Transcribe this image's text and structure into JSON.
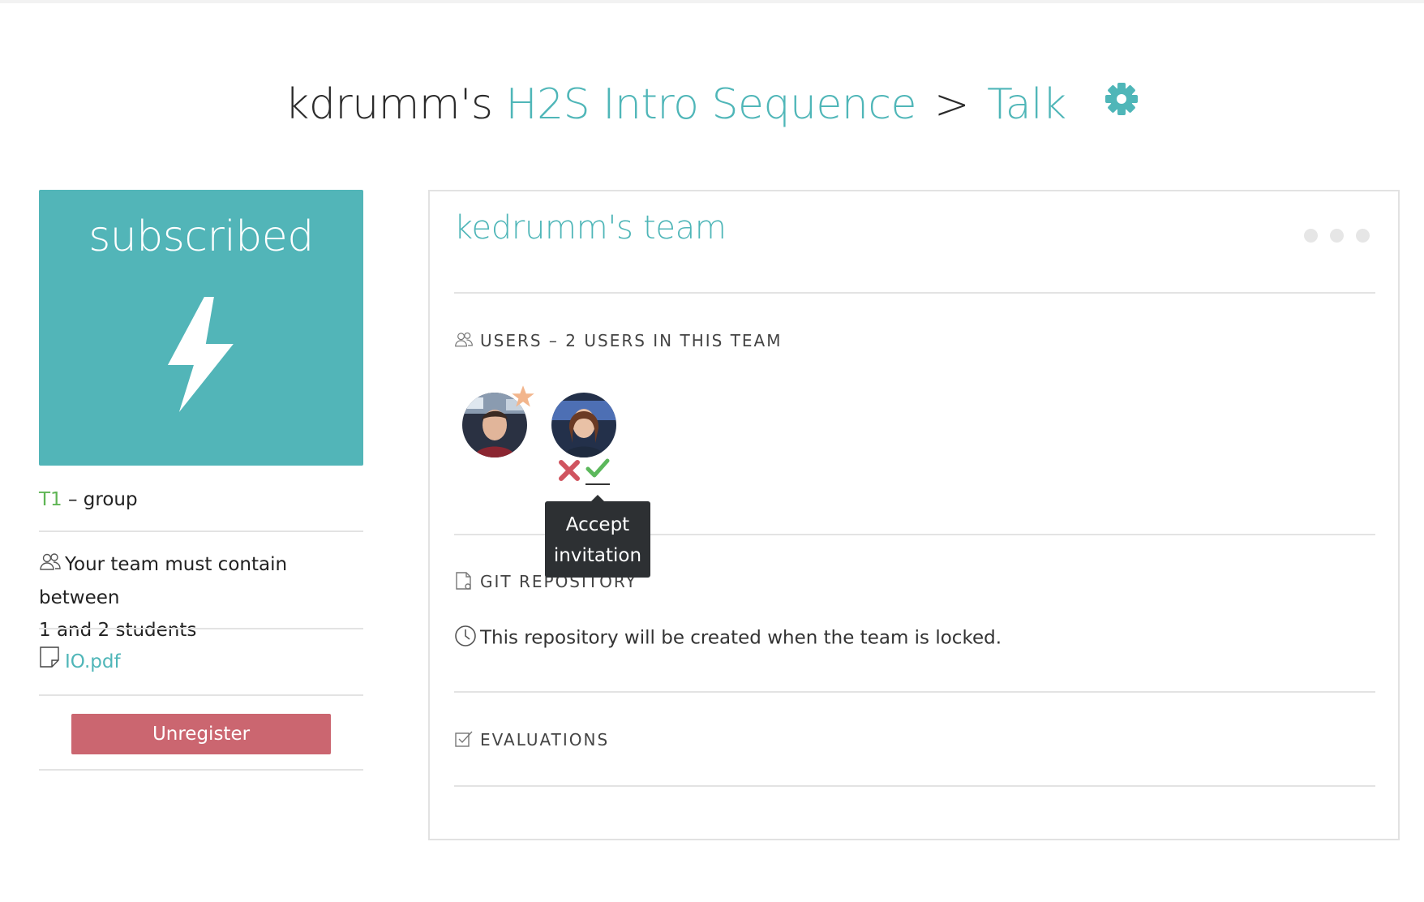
{
  "title": {
    "owner": "kdrumm's",
    "project": "H2S Intro Sequence",
    "separator": ">",
    "subpage": "Talk"
  },
  "left": {
    "status_label": "subscribed",
    "group_code": "T1",
    "group_suffix": "– group",
    "team_rule_line1": "Your team must contain between",
    "team_rule_line2": "1 and 2 students",
    "attachment": "IO.pdf",
    "unregister_label": "Unregister"
  },
  "team": {
    "name": "kedrumm's team",
    "users_heading": "USERS – 2 USERS IN THIS TEAM",
    "tooltip_line1": "Accept",
    "tooltip_line2": "invitation",
    "git_heading": "GIT REPOSITORY",
    "repo_status": "This repository will be created when the team is locked.",
    "evaluations_heading": "EVALUATIONS"
  },
  "colors": {
    "accent": "#4fb6b8",
    "subscribed_bg": "#52b5b8",
    "unregister_bg": "#cb6670",
    "group_code": "#5fb554",
    "reject": "#d0545f",
    "accept": "#5cb85c",
    "leader_star": "#f2b58c"
  },
  "icons": [
    "gear-icon",
    "bolt-icon",
    "users-icon",
    "file-icon",
    "git-icon",
    "clock-icon",
    "checkbox-icon",
    "star-icon",
    "reject-icon",
    "accept-icon"
  ]
}
